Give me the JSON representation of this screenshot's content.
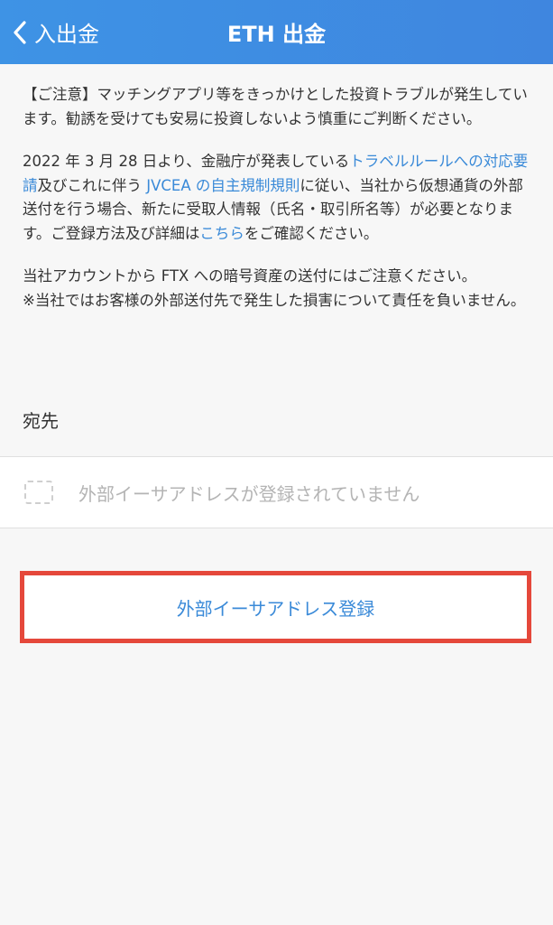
{
  "header": {
    "back_label": "入出金",
    "title": "ETH 出金"
  },
  "notice": {
    "p1": "【ご注意】マッチングアプリ等をきっかけとした投資トラブルが発生しています。勧誘を受けても安易に投資しないよう慎重にご判断ください。",
    "p2_part1": "2022 年 3 月 28 日より、金融庁が発表している",
    "p2_link1": "トラベルルールへの対応要請",
    "p2_part2": "及びこれに伴う ",
    "p2_link2": "JVCEA の自主規制規則",
    "p2_part3": "に従い、当社から仮想通貨の外部送付を行う場合、新たに受取人情報（氏名・取引所名等）が必要となります。ご登録方法及び詳細は",
    "p2_link3": "こちら",
    "p2_part4": "をご確認ください。",
    "p3_line1": "当社アカウントから FTX への暗号資産の送付にはご注意ください。",
    "p3_line2": "※当社ではお客様の外部送付先で発生した損害について責任を負いません。"
  },
  "destination": {
    "label": "宛先",
    "empty_text": "外部イーサアドレスが登録されていません"
  },
  "register": {
    "label": "外部イーサアドレス登録"
  },
  "colors": {
    "header": "#3f8ce2",
    "link": "#3a8ad8",
    "highlight_border": "#e5483b"
  }
}
